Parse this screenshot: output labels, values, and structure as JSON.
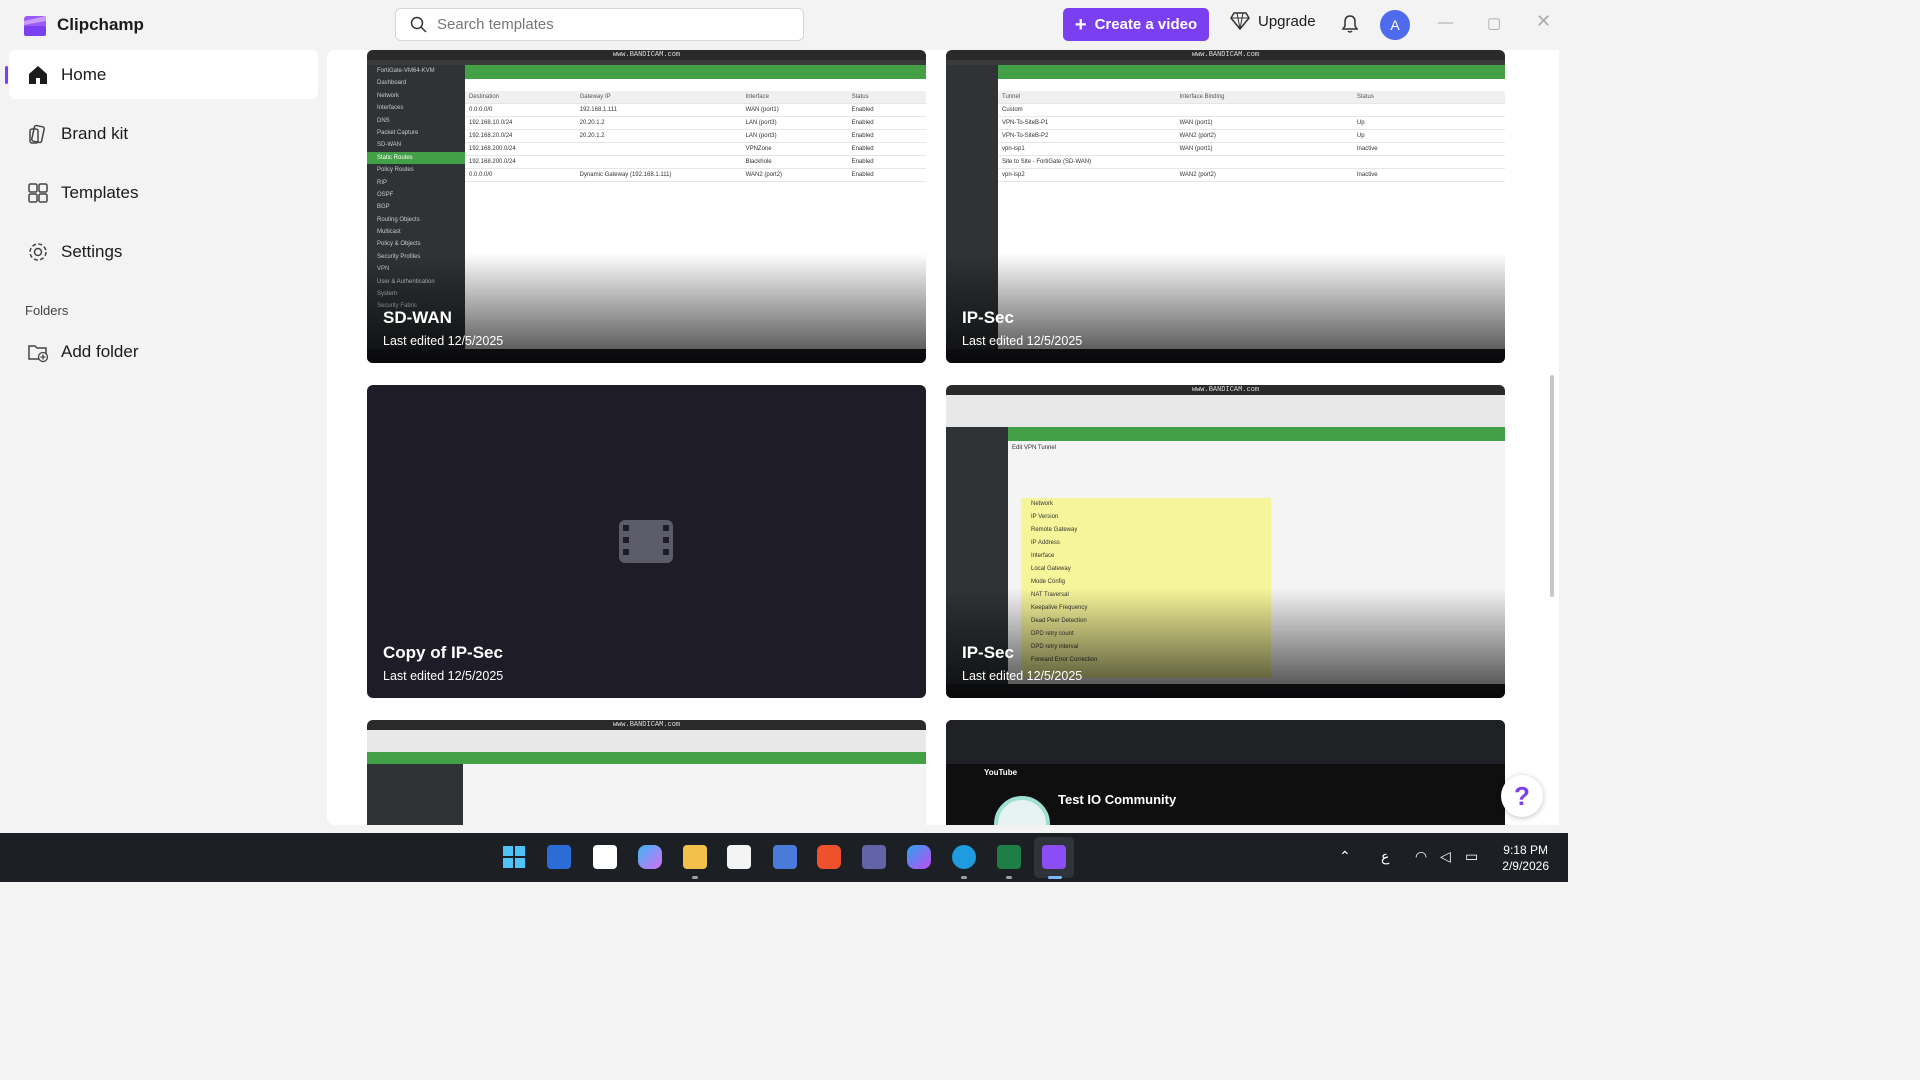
{
  "app": {
    "name": "Clipchamp"
  },
  "search": {
    "placeholder": "Search templates"
  },
  "header": {
    "create_label": "Create a video",
    "upgrade_label": "Upgrade",
    "avatar_initial": "A"
  },
  "sidebar": {
    "items": [
      {
        "label": "Home",
        "icon": "home-icon"
      },
      {
        "label": "Brand kit",
        "icon": "brand-kit-icon"
      },
      {
        "label": "Templates",
        "icon": "templates-icon"
      },
      {
        "label": "Settings",
        "icon": "gear-icon"
      }
    ],
    "folders_label": "Folders",
    "add_folder_label": "Add folder"
  },
  "projects": [
    {
      "title": "SD-WAN",
      "meta": "Last edited 12/5/2025"
    },
    {
      "title": "IP-Sec",
      "meta": "Last edited 12/5/2025"
    },
    {
      "title": "Copy of IP-Sec",
      "meta": "Last edited 12/5/2025"
    },
    {
      "title": "IP-Sec",
      "meta": "Last edited 12/5/2025"
    }
  ],
  "thumbs": {
    "recorder": "www.BANDICAM.com",
    "sdwan_side": [
      "FortiGate-VM64-KVM",
      "Dashboard",
      "Network",
      "Interfaces",
      "DNS",
      "Packet Capture",
      "SD-WAN",
      "Static Routes",
      "Policy Routes",
      "RIP",
      "OSPF",
      "BGP",
      "Routing Objects",
      "Multicast",
      "Policy & Objects",
      "Security Profiles",
      "VPN",
      "User & Authentication",
      "System",
      "Security Fabric"
    ],
    "sdwan_head": [
      "Destination",
      "Gateway IP",
      "Interface",
      "Status"
    ],
    "sdwan_rows": [
      [
        "0.0.0.0/0",
        "192.168.1.111",
        "WAN (port1)",
        "Enabled"
      ],
      [
        "192.168.10.0/24",
        "20.20.1.2",
        "LAN (port3)",
        "Enabled"
      ],
      [
        "192.168.20.0/24",
        "20.20.1.2",
        "LAN (port3)",
        "Enabled"
      ],
      [
        "192.168.200.0/24",
        "",
        "VPNZone",
        "Enabled"
      ],
      [
        "192.168.200.0/24",
        "",
        "Blackhole",
        "Enabled"
      ],
      [
        "0.0.0.0/0",
        "Dynamic Gateway (192.168.1.111)",
        "WAN2 (port2)",
        "Enabled"
      ]
    ],
    "ipsec_head": [
      "Tunnel",
      "Interface Binding",
      "Status"
    ],
    "ipsec_rows": [
      [
        "Custom",
        "",
        ""
      ],
      [
        "VPN-To-SiteB-P1",
        "WAN (port1)",
        "Up"
      ],
      [
        "VPN-To-SiteB-P2",
        "WAN2 (port2)",
        "Up"
      ],
      [
        "vpn-isp1",
        "WAN (port1)",
        "Inactive"
      ],
      [
        "Site to Site - FortiGate (SD-WAN)",
        "",
        ""
      ],
      [
        "vpn-isp2",
        "WAN2 (port2)",
        "Inactive"
      ]
    ],
    "vpn_title": "Edit VPN Tunnel",
    "vpn_lines": [
      "Network",
      "IP Version",
      "Remote Gateway",
      "IP Address",
      "Interface",
      "Local Gateway",
      "Mode Config",
      "NAT Traversal",
      "Keepalive Frequency",
      "Dead Peer Detection",
      "DPD retry count",
      "DPD retry interval",
      "Forward Error Correction"
    ],
    "yt_channel": "Test IO Community",
    "yt_logo": "YouTube"
  },
  "taskbar": {
    "time": "9:18 PM",
    "date": "2/9/2026"
  },
  "colors": {
    "accent": "#7b3ff2",
    "forti_green": "#43a047",
    "taskbar": "#1c1f24"
  }
}
